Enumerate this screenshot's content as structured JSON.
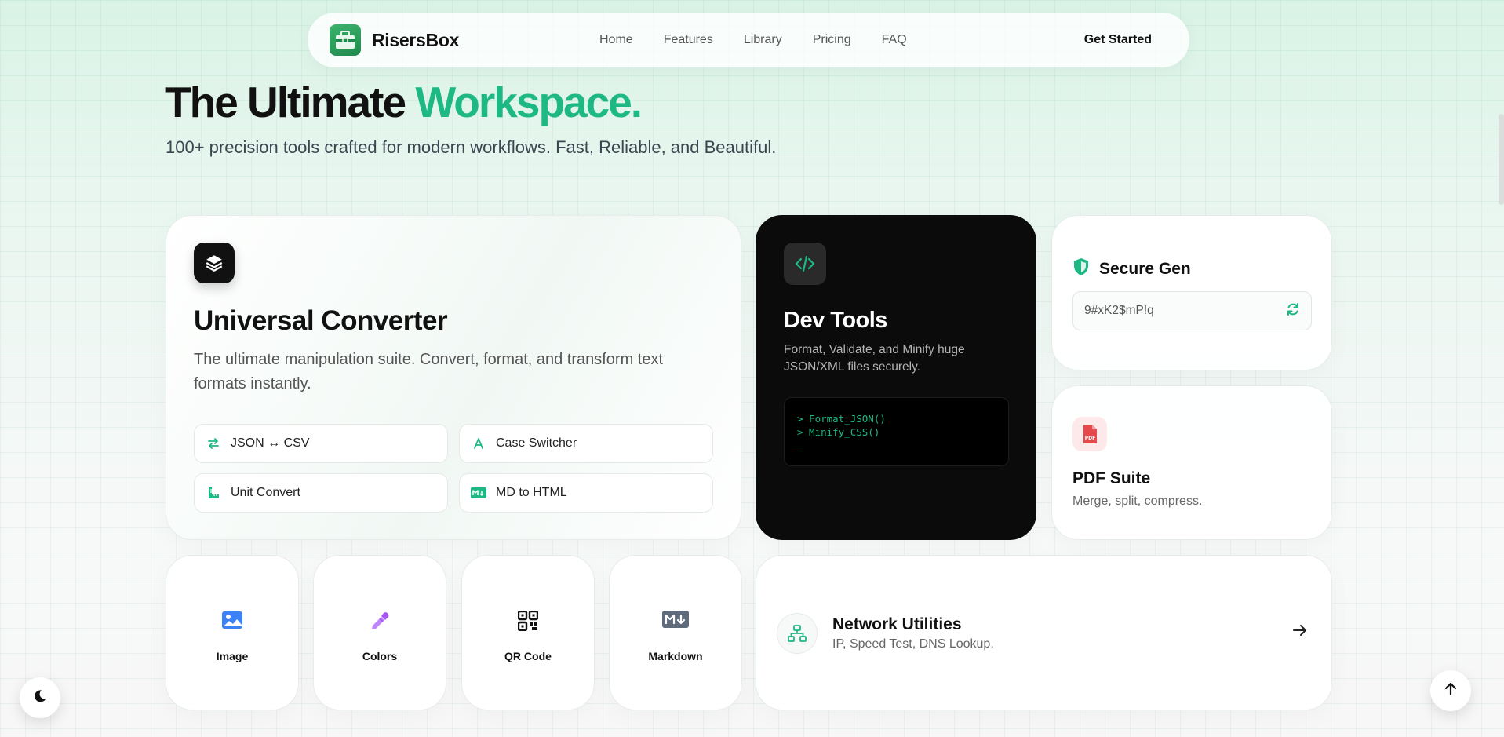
{
  "nav": {
    "brand": "RisersBox",
    "links": [
      "Home",
      "Features",
      "Library",
      "Pricing",
      "FAQ"
    ],
    "cta": "Get Started"
  },
  "hero": {
    "title_main": "The Ultimate ",
    "title_accent": "Workspace.",
    "subtitle": "100+ precision tools crafted for modern workflows. Fast, Reliable, and Beautiful."
  },
  "converter": {
    "title": "Universal Converter",
    "description": "The ultimate manipulation suite. Convert, format, and transform text formats instantly.",
    "chips": [
      "JSON ↔ CSV",
      "Case Switcher",
      "Unit Convert",
      "MD to HTML"
    ]
  },
  "dev": {
    "title": "Dev Tools",
    "description": "Format, Validate, and Minify huge JSON/XML files securely.",
    "terminal": [
      "> Format_JSON()",
      "> Minify_CSS()",
      "_"
    ]
  },
  "secure": {
    "title": "Secure Gen",
    "password": "9#xK2$mP!q"
  },
  "pdf": {
    "title": "PDF Suite",
    "description": "Merge, split, compress."
  },
  "tools": [
    "Image",
    "Colors",
    "QR Code",
    "Markdown"
  ],
  "network": {
    "title": "Network Utilities",
    "description": "IP, Speed Test, DNS Lookup."
  },
  "icons": {
    "logo": "toolbox-icon",
    "converter": "layers-icon",
    "dev": "code-icon",
    "secure": "shield-icon",
    "refresh": "refresh-icon",
    "pdf": "pdf-file-icon",
    "image": "image-icon",
    "colors": "eyedropper-icon",
    "qr": "qr-code-icon",
    "markdown": "markdown-icon",
    "network": "network-icon",
    "arrow": "arrow-right-icon",
    "theme": "moon-icon",
    "top": "arrow-up-icon"
  },
  "colors": {
    "accent": "#1db884",
    "dark": "#0b0b0b",
    "pdf": "#e5484d",
    "image": "#3b82f6",
    "colors_icon": "#a855f7"
  }
}
